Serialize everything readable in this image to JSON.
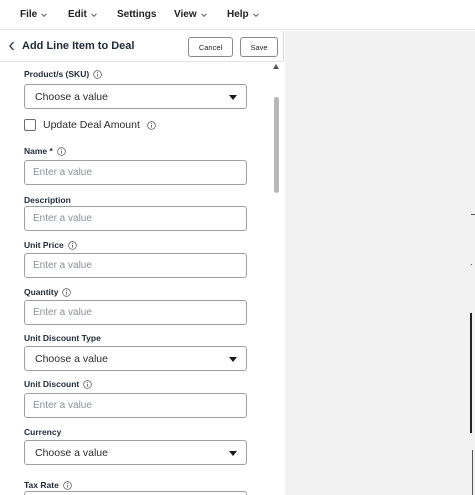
{
  "menu": {
    "file": "File",
    "edit": "Edit",
    "settings": "Settings",
    "view": "View",
    "help": "Help"
  },
  "panel": {
    "title": "Add Line Item to Deal",
    "cancel_label": "Cancel",
    "save_label": "Save"
  },
  "form": {
    "product": {
      "label": "Product/s (SKU)",
      "value": "Choose a value"
    },
    "update_deal": {
      "label": "Update Deal Amount",
      "checked": false
    },
    "name": {
      "label": "Name *",
      "placeholder": "Enter a value"
    },
    "description": {
      "label": "Description",
      "placeholder": "Enter a value"
    },
    "unit_price": {
      "label": "Unit Price",
      "placeholder": "Enter a value"
    },
    "quantity": {
      "label": "Quantity",
      "placeholder": "Enter a value"
    },
    "unit_discount_type": {
      "label": "Unit Discount Type",
      "value": "Choose a value"
    },
    "unit_discount": {
      "label": "Unit Discount",
      "placeholder": "Enter a value"
    },
    "currency": {
      "label": "Currency",
      "value": "Choose a value"
    },
    "tax_rate": {
      "label": "Tax Rate"
    }
  },
  "icons": {
    "info": "info-circle-icon",
    "chevron": "chevron-down-icon",
    "back": "chevron-left-icon"
  }
}
